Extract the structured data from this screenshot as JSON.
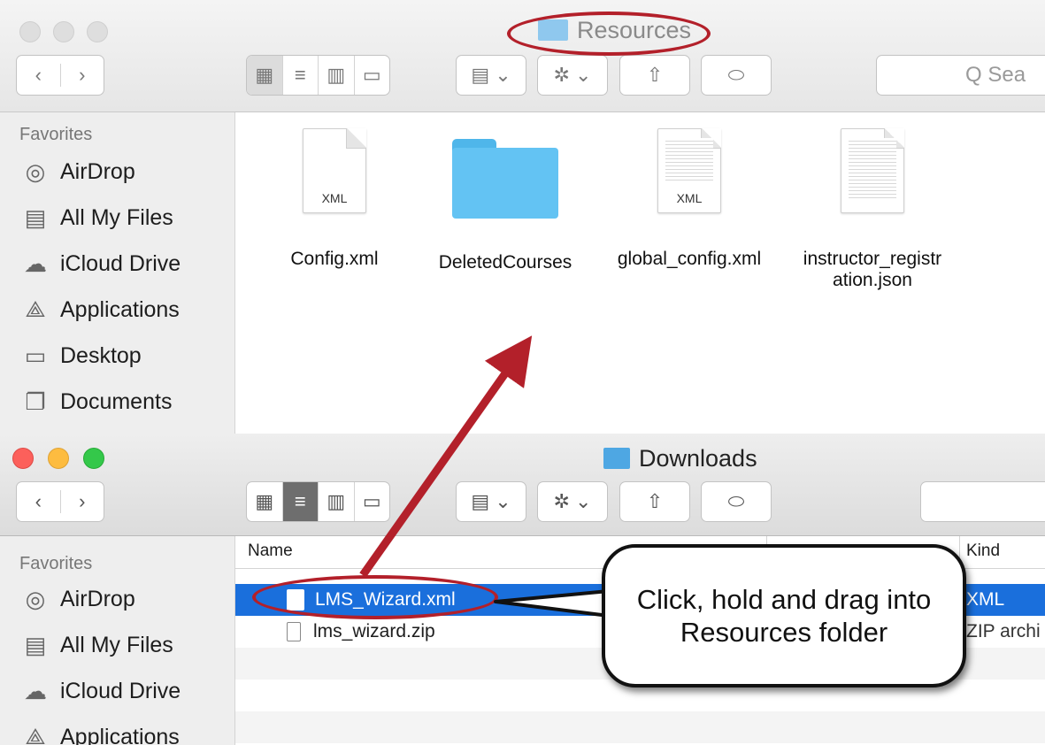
{
  "resources_window": {
    "title": "Resources",
    "search_placeholder": "Q Sea",
    "sidebar": {
      "heading": "Favorites",
      "items": [
        {
          "label": "AirDrop",
          "icon": "airdrop-icon"
        },
        {
          "label": "All My Files",
          "icon": "all-files-icon"
        },
        {
          "label": "iCloud Drive",
          "icon": "cloud-icon"
        },
        {
          "label": "Applications",
          "icon": "applications-icon"
        },
        {
          "label": "Desktop",
          "icon": "desktop-icon"
        },
        {
          "label": "Documents",
          "icon": "documents-icon"
        }
      ]
    },
    "files": [
      {
        "name": "Config.xml",
        "badge": "XML"
      },
      {
        "name": "DeletedCourses",
        "badge": ""
      },
      {
        "name": "global_config.xml",
        "badge": "XML"
      },
      {
        "name": "instructor_registr ation.json",
        "badge": ""
      }
    ]
  },
  "downloads_window": {
    "title": "Downloads",
    "sidebar": {
      "heading": "Favorites",
      "items": [
        {
          "label": "AirDrop",
          "icon": "airdrop-icon"
        },
        {
          "label": "All My Files",
          "icon": "all-files-icon"
        },
        {
          "label": "iCloud Drive",
          "icon": "cloud-icon"
        },
        {
          "label": "Applications",
          "icon": "applications-icon"
        }
      ]
    },
    "columns": {
      "name": "Name",
      "kind": "Kind"
    },
    "rows": [
      {
        "name": "LMS_Wizard.xml",
        "kind": "XML"
      },
      {
        "name": "lms_wizard.zip",
        "kind": "ZIP archi"
      }
    ]
  },
  "annotation": {
    "callout_text": "Click, hold and drag into Resources folder",
    "highlight_color": "#b3202a"
  }
}
